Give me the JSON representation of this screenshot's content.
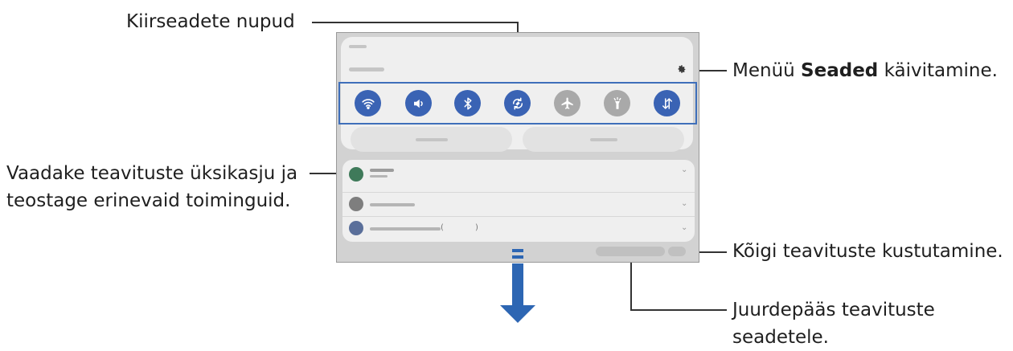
{
  "callouts": {
    "quick_buttons": "Kiirseadete nupud",
    "settings_prefix": "Menüü ",
    "settings_bold": "Seaded",
    "settings_suffix": " käivitamine.",
    "details_line1": "Vaadake teavituste üksikasju ja",
    "details_line2": "teostage erinevaid toiminguid.",
    "clear_all": "Kõigi teavituste kustutamine.",
    "notif_settings_line1": "Juurdepääs teavituste",
    "notif_settings_line2": "seadetele."
  },
  "quick_panel": {
    "icons": [
      "gear-icon"
    ],
    "tiles": [
      {
        "name": "wifi",
        "icon": "wifi-icon",
        "active": true
      },
      {
        "name": "sound",
        "icon": "speaker-icon",
        "active": true
      },
      {
        "name": "bluetooth",
        "icon": "bluetooth-icon",
        "active": true
      },
      {
        "name": "auto-rotate",
        "icon": "rotate-icon",
        "active": true
      },
      {
        "name": "airplane",
        "icon": "airplane-icon",
        "active": false
      },
      {
        "name": "flashlight",
        "icon": "flashlight-icon",
        "active": false
      },
      {
        "name": "mobile-data",
        "icon": "data-arrows-icon",
        "active": true
      }
    ],
    "colors": {
      "active_tile": "#3a63b4",
      "inactive_tile": "#a9a9a9",
      "highlight": "#3f6fba",
      "arrow": "#2d66b3"
    }
  }
}
